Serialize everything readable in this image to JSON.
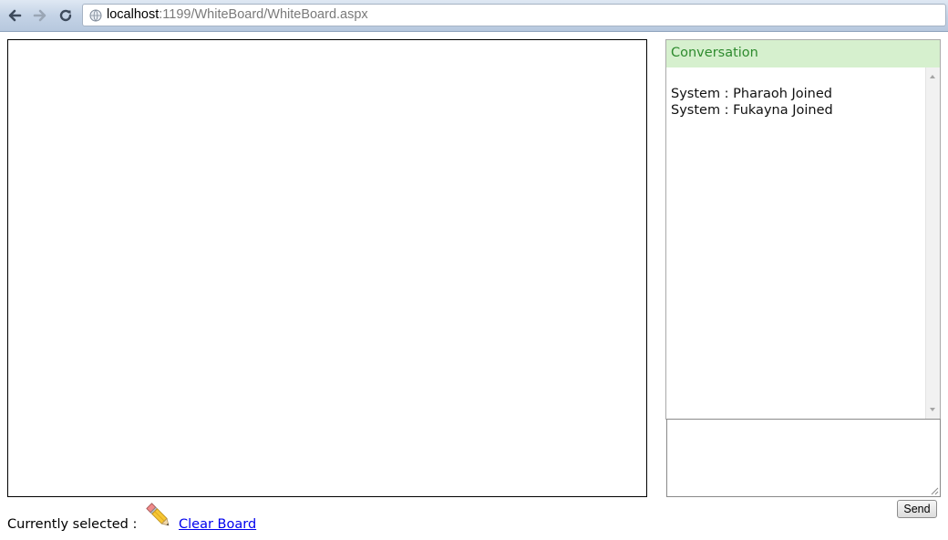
{
  "browser": {
    "url_host": "localhost",
    "url_rest": ":1199/WhiteBoard/WhiteBoard.aspx"
  },
  "chat": {
    "header": "Conversation",
    "messages": [
      "System : Pharaoh Joined",
      "System : Fukayna Joined"
    ],
    "message_input_value": "",
    "send_label": "Send"
  },
  "footer": {
    "selected_label": "Currently selected :",
    "selected_tool_icon": "pencil-icon",
    "clear_label": "Clear Board"
  },
  "colors": {
    "chat_header_bg": "#d6f0ce",
    "chat_header_text": "#2e8b2e",
    "link": "#0000ee"
  }
}
